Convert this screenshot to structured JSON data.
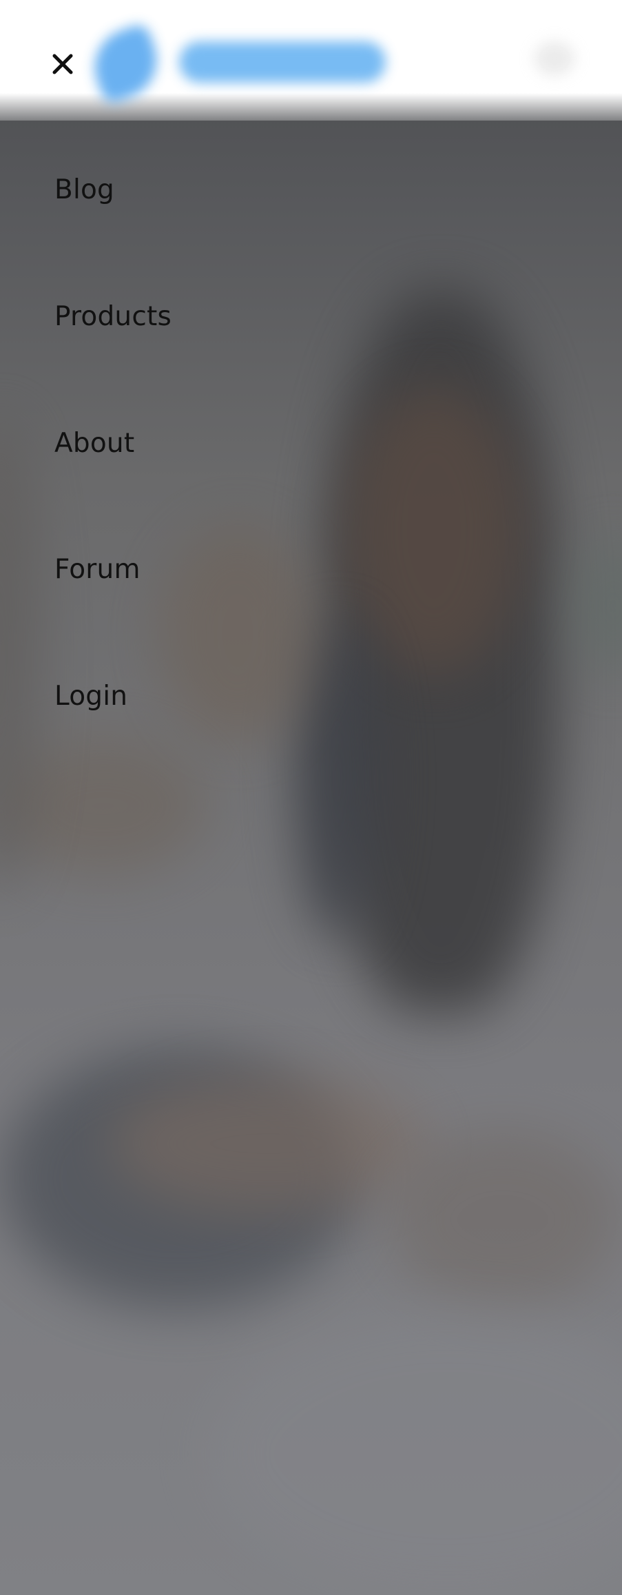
{
  "header": {
    "close_icon": "close-icon",
    "logo_icon": "brand-logo",
    "brand_color": "#5aa9f0"
  },
  "menu": {
    "items": [
      {
        "label": "Blog"
      },
      {
        "label": "Products"
      },
      {
        "label": "About"
      },
      {
        "label": "Forum"
      },
      {
        "label": "Login"
      }
    ]
  },
  "colors": {
    "overlay": "#58595c",
    "menu_text": "#111111",
    "header_bg": "#ffffff"
  }
}
